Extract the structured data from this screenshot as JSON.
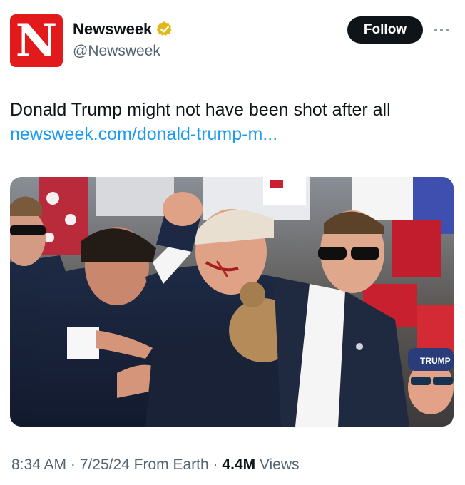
{
  "account": {
    "avatar_letter": "N",
    "display_name": "Newsweek",
    "handle": "@Newsweek",
    "verified_badge_icon": "gold-verified-badge-icon",
    "brand_color": "#e31a1c"
  },
  "actions": {
    "follow_label": "Follow",
    "more_icon": "more-horizontal-icon"
  },
  "tweet": {
    "text": "Donald Trump might not have been shot after all",
    "link_text": "newsweek.com/donald-trump-m...",
    "link_color": "#1d9bf0"
  },
  "media": {
    "type": "photo",
    "overlay_text": "TRUMP"
  },
  "meta": {
    "time": "8:34 AM",
    "separator": "·",
    "date": "7/25/24",
    "source": "From Earth",
    "views_count": "4.4M",
    "views_label": "Views"
  }
}
